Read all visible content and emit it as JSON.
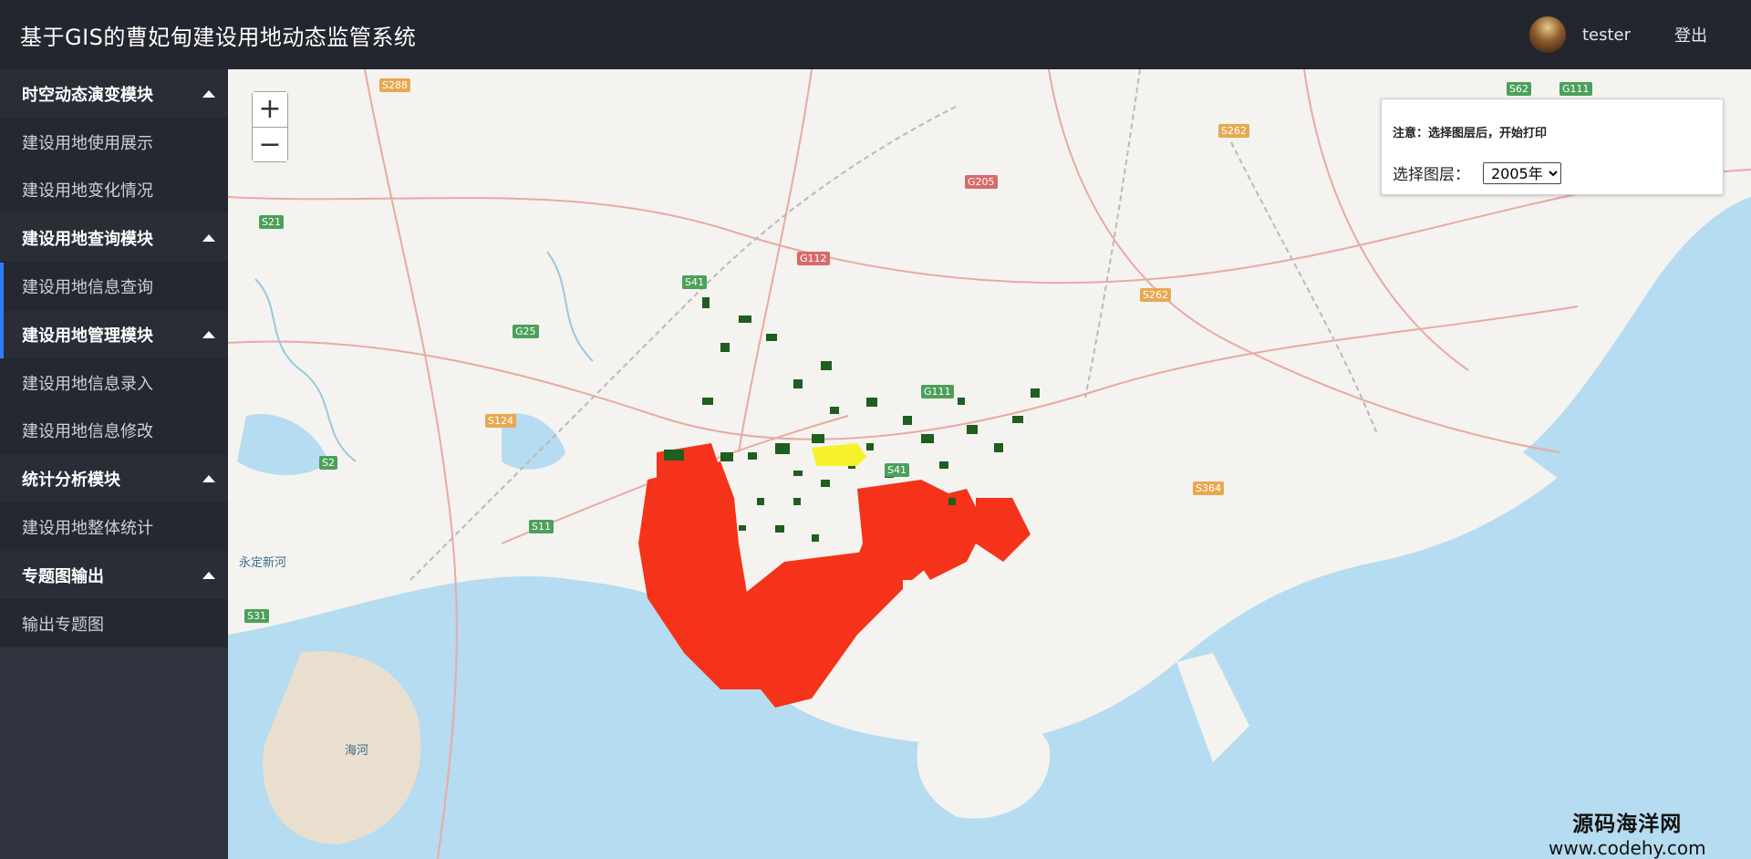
{
  "header": {
    "title": "基于GIS的曹妃甸建设用地动态监管系统",
    "username": "tester",
    "logout_label": "登出"
  },
  "sidebar": {
    "groups": [
      {
        "title": "时空动态演变模块",
        "items": [
          "建设用地使用展示",
          "建设用地变化情况"
        ]
      },
      {
        "title": "建设用地查询模块",
        "items": [
          "建设用地信息查询"
        ]
      },
      {
        "title": "建设用地管理模块",
        "items": [
          "建设用地信息录入",
          "建设用地信息修改"
        ]
      },
      {
        "title": "统计分析模块",
        "items": [
          "建设用地整体统计"
        ]
      },
      {
        "title": "专题图输出",
        "items": [
          "输出专题图"
        ]
      }
    ]
  },
  "map": {
    "zoom_in": "+",
    "zoom_out": "−",
    "road_labels": [
      "S288",
      "S262",
      "G205",
      "S21",
      "G112",
      "S41",
      "S262",
      "G25",
      "S124",
      "G111",
      "S2",
      "S41",
      "S11",
      "S364",
      "S31",
      "S62",
      "G111"
    ],
    "place_labels": [
      "永定新河",
      "海河"
    ],
    "colors": {
      "water": "#b5dcf0",
      "land": "#f4f3f0",
      "built_red": "#f5331a",
      "built_green": "#1e5e1e",
      "built_yellow": "#f5f22c"
    }
  },
  "print_panel": {
    "note": "注意：选择图层后，开始打印",
    "layer_label": "选择图层：",
    "selected_layer": "2005年"
  },
  "watermark": {
    "line1": "源码海洋网",
    "line2": "www.codehy.com"
  }
}
